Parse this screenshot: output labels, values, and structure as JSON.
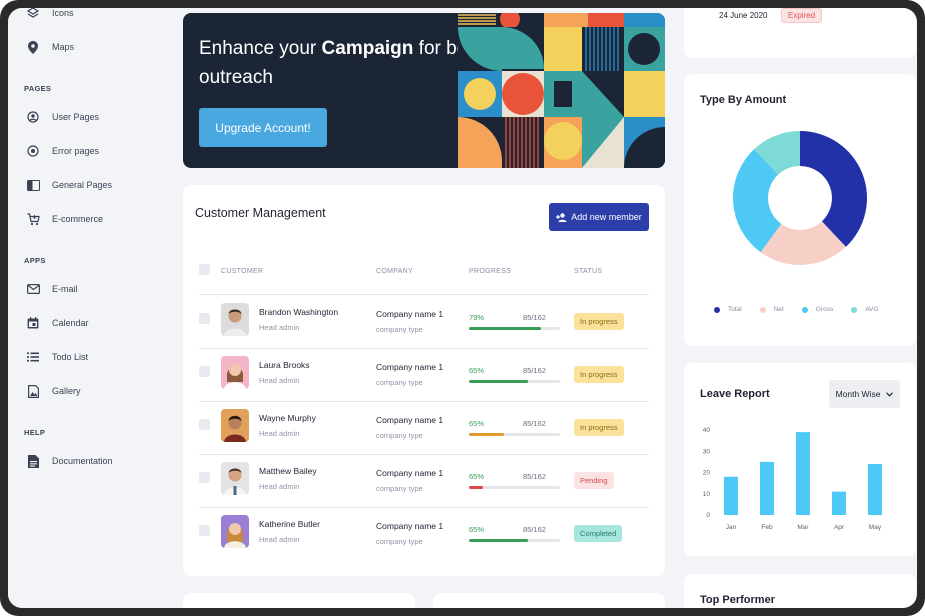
{
  "sidebar": {
    "items_top": [
      {
        "label": "Icons",
        "icon": "layers-icon"
      },
      {
        "label": "Maps",
        "icon": "map-pin-icon"
      }
    ],
    "pages_heading": "PAGES",
    "pages": [
      {
        "label": "User Pages",
        "icon": "user-circle-icon"
      },
      {
        "label": "Error pages",
        "icon": "error-circle-icon"
      },
      {
        "label": "General Pages",
        "icon": "book-icon"
      },
      {
        "label": "E-commerce",
        "icon": "cart-icon"
      }
    ],
    "apps_heading": "APPS",
    "apps": [
      {
        "label": "E-mail",
        "icon": "mail-icon"
      },
      {
        "label": "Calendar",
        "icon": "calendar-icon"
      },
      {
        "label": "Todo List",
        "icon": "list-icon"
      },
      {
        "label": "Gallery",
        "icon": "image-icon"
      }
    ],
    "help_heading": "HELP",
    "help": [
      {
        "label": "Documentation",
        "icon": "document-icon"
      }
    ]
  },
  "banner": {
    "title_prefix": "Enhance your ",
    "title_bold": "Campaign",
    "title_suffix": " for better outreach",
    "button": "Upgrade Account!"
  },
  "customers": {
    "title": "Customer Management",
    "add_button": "Add new member",
    "columns": {
      "customer": "CUSTOMER",
      "company": "COMPANY",
      "progress": "PROGRESS",
      "status": "STATUS"
    },
    "rows": [
      {
        "name": "Brandon Washington",
        "role": "Head admin",
        "company": "Company name 1",
        "company_type": "company type",
        "progress_label": "79%",
        "progress": 0.79,
        "count": "85/162",
        "status": "In progress",
        "bar_color": "#3a9e57",
        "pct_color": "#3a9e57",
        "status_bg": "#fbe29b",
        "status_color": "#8a6a12"
      },
      {
        "name": "Laura Brooks",
        "role": "Head admin",
        "company": "Company name 1",
        "company_type": "company type",
        "progress_label": "65%",
        "progress": 0.65,
        "count": "85/162",
        "status": "In progress",
        "bar_color": "#3a9e57",
        "pct_color": "#3a9e57",
        "status_bg": "#fbe29b",
        "status_color": "#8a6a12"
      },
      {
        "name": "Wayne Murphy",
        "role": "Head admin",
        "company": "Company name 1",
        "company_type": "company type",
        "progress_label": "65%",
        "progress": 0.38,
        "count": "85/162",
        "status": "In progress",
        "bar_color": "#e49b2e",
        "pct_color": "#3a9e57",
        "status_bg": "#fbe29b",
        "status_color": "#8a6a12"
      },
      {
        "name": "Matthew Bailey",
        "role": "Head admin",
        "company": "Company name 1",
        "company_type": "company type",
        "progress_label": "65%",
        "progress": 0.15,
        "count": "85/162",
        "status": "Pending",
        "bar_color": "#e04848",
        "pct_color": "#3a9e57",
        "status_bg": "#fbe3e3",
        "status_color": "#d84a4a"
      },
      {
        "name": "Katherine Butler",
        "role": "Head admin",
        "company": "Company name 1",
        "company_type": "company type",
        "progress_label": "65%",
        "progress": 0.65,
        "count": "85/162",
        "status": "Completed",
        "bar_color": "#3a9e57",
        "pct_color": "#3a9e57",
        "status_bg": "#a6e6dc",
        "status_color": "#2a7a6c"
      }
    ]
  },
  "expired_item": {
    "date": "24 June 2020",
    "status": "Expired"
  },
  "type_by_amount": {
    "title": "Type By Amount",
    "legend": [
      {
        "label": "Total",
        "color": "#2231a8"
      },
      {
        "label": "Net",
        "color": "#f6cfc6"
      },
      {
        "label": "Gross",
        "color": "#4ec8f4"
      },
      {
        "label": "AVG",
        "color": "#7ddad6"
      }
    ]
  },
  "leave_report": {
    "title": "Leave Report",
    "filter": "Month Wise"
  },
  "top_performer": {
    "title": "Top Performer"
  },
  "chart_data": [
    {
      "type": "pie",
      "title": "Type By Amount",
      "labels": [
        "Total",
        "Net",
        "Gross",
        "AVG"
      ],
      "values": [
        38,
        22,
        28,
        12
      ],
      "colors": [
        "#2231a8",
        "#f6cfc6",
        "#4ec8f4",
        "#7ddad6"
      ]
    },
    {
      "type": "bar",
      "title": "Leave Report",
      "categories": [
        "Jan",
        "Feb",
        "Mar",
        "Apr",
        "May"
      ],
      "values": [
        18,
        25,
        39,
        11,
        24
      ],
      "ylim": [
        0,
        40
      ],
      "yticks": [
        0,
        10,
        20,
        30,
        40
      ],
      "color": "#4ec8f4"
    }
  ]
}
